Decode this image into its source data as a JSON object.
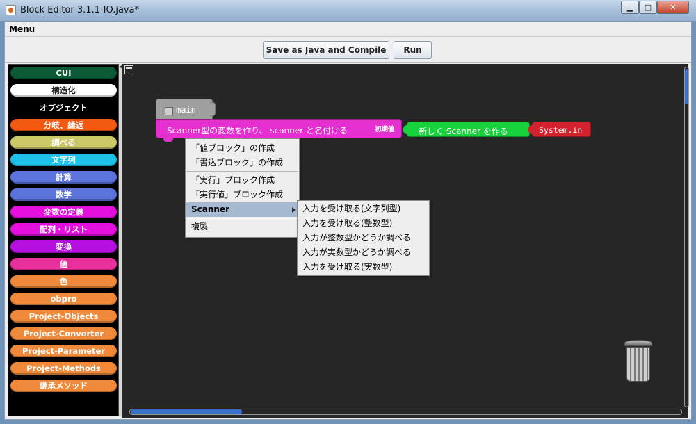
{
  "window": {
    "title": "Block Editor 3.1.1-IO.java*",
    "minimize": "▁",
    "maximize": "□",
    "close": "✕"
  },
  "menubar": {
    "menu_label": "Menu"
  },
  "toolbar": {
    "compile_label": "Save as Java and Compile",
    "run_label": "Run"
  },
  "palette": {
    "items": [
      {
        "label": "CUI",
        "color": "#0c5b36",
        "text_color": "#ffffff"
      },
      {
        "label": "構造化",
        "color": "#ffffff",
        "text_color": "#222222"
      },
      {
        "label": "オブジェクト",
        "color": "#000000",
        "text_color": "#ffffff"
      },
      {
        "label": "分岐、繰返",
        "color": "#f25a12",
        "text_color": "#ffffff"
      },
      {
        "label": "調べる",
        "color": "#cbc868",
        "text_color": "#ffffff"
      },
      {
        "label": "文字列",
        "color": "#1ec0e8",
        "text_color": "#ffffff"
      },
      {
        "label": "計算",
        "color": "#5c74dc",
        "text_color": "#ffffff"
      },
      {
        "label": "数学",
        "color": "#5c74dc",
        "text_color": "#ffffff"
      },
      {
        "label": "変数の定義",
        "color": "#e510df",
        "text_color": "#ffffff"
      },
      {
        "label": "配列・リスト",
        "color": "#e510df",
        "text_color": "#ffffff"
      },
      {
        "label": "変換",
        "color": "#b510df",
        "text_color": "#ffffff"
      },
      {
        "label": "値",
        "color": "#e8309c",
        "text_color": "#ffffff"
      },
      {
        "label": "色",
        "color": "#f08a3a",
        "text_color": "#ffffff"
      },
      {
        "label": "obpro",
        "color": "#f08a3a",
        "text_color": "#ffffff"
      },
      {
        "label": "Project-Objects",
        "color": "#f08a3a",
        "text_color": "#ffffff"
      },
      {
        "label": "Project-Converter",
        "color": "#f08a3a",
        "text_color": "#ffffff"
      },
      {
        "label": "Project-Parameter",
        "color": "#f08a3a",
        "text_color": "#ffffff"
      },
      {
        "label": "Project-Methods",
        "color": "#f08a3a",
        "text_color": "#ffffff"
      },
      {
        "label": "継承メソッド",
        "color": "#f08a3a",
        "text_color": "#ffffff"
      }
    ]
  },
  "workspace": {
    "main_label": "main",
    "var_block": {
      "label": "Scanner型の変数を作り、 scanner と名付ける",
      "init_label": "初期値"
    },
    "new_block_label": "新しく Scanner を作る",
    "system_in_label": "System.in"
  },
  "context_menu": {
    "items": [
      "「値ブロック」の作成",
      "「書込ブロック」の作成",
      "「実行」ブロック作成",
      "「実行値」ブロック作成",
      "Scanner",
      "複製"
    ]
  },
  "submenu": {
    "items": [
      "入力を受け取る(文字列型)",
      "入力を受け取る(整数型)",
      "入力が整数型かどうか調べる",
      "入力が実数型かどうか調べる",
      "入力を受け取る(実数型)"
    ]
  }
}
